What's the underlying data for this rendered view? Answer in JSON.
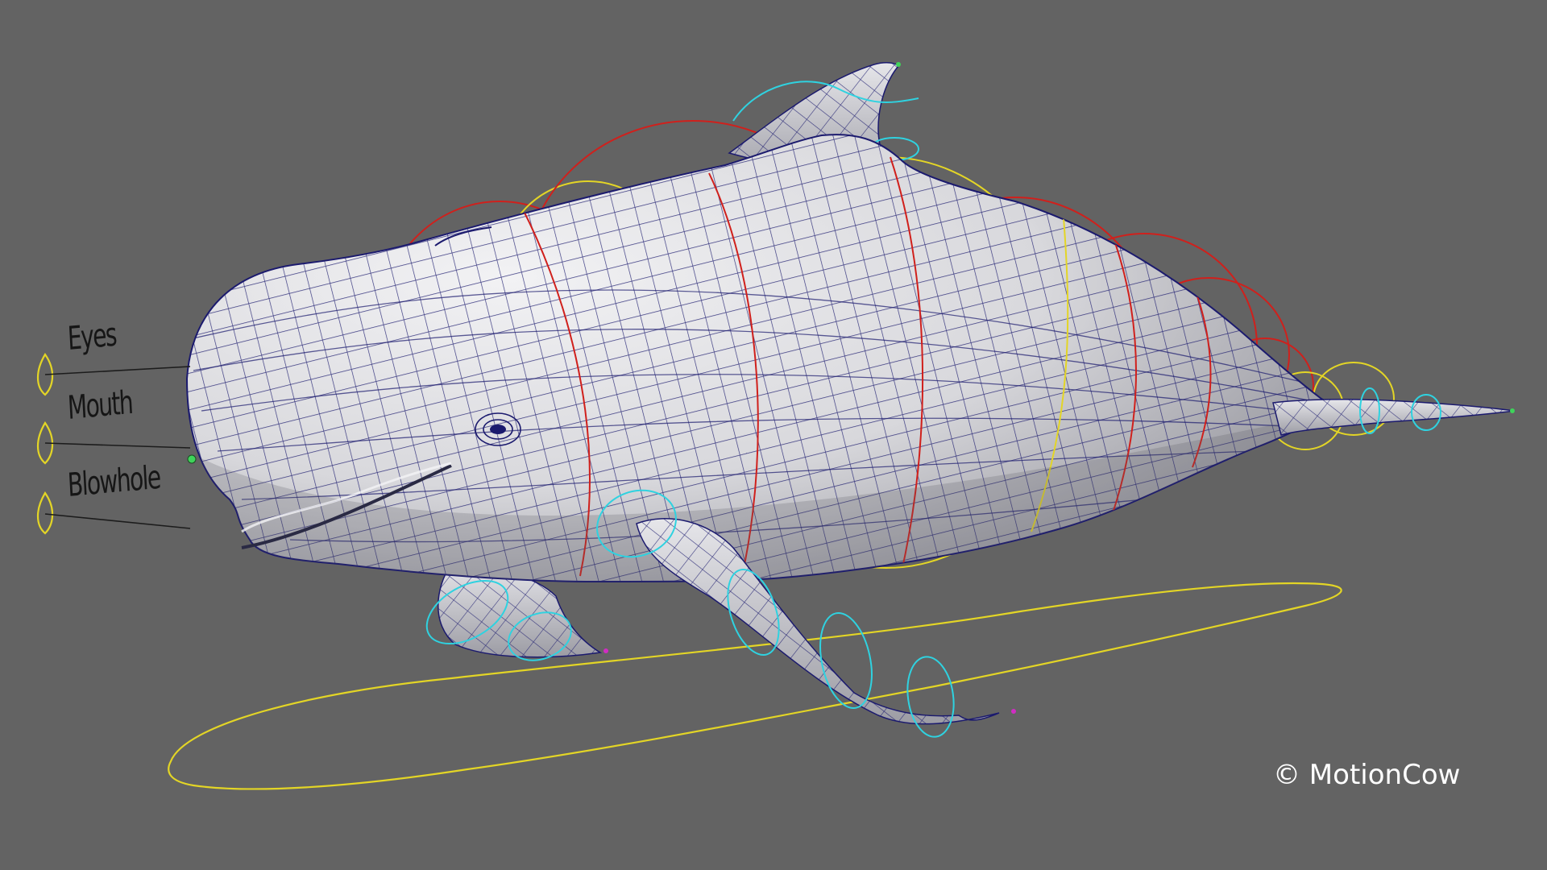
{
  "viewport": {
    "background": "#636363",
    "subject": "dolphin-rig"
  },
  "labels": {
    "eyes": "Eyes",
    "mouth": "Mouth",
    "blowhole": "Blowhole"
  },
  "copyright": "© MotionCow",
  "colors": {
    "mesh_fill": "#d7d7d9",
    "wireframe": "#1b1a6e",
    "ctrl_red": "#d0201c",
    "ctrl_yellow": "#e3d526",
    "ctrl_cyan": "#2fd2e0",
    "pivot_green": "#3fd35a",
    "pivot_magenta": "#d12cc3"
  }
}
